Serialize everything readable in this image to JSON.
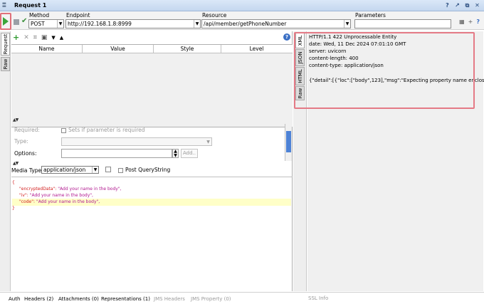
{
  "window": {
    "title": "Request 1",
    "grip_icon": "grip-icon",
    "controls": [
      "help-icon",
      "popout-icon",
      "restore-icon",
      "close-icon"
    ]
  },
  "toolbar": {
    "method_label": "Method",
    "method_value": "POST",
    "endpoint_label": "Endpoint",
    "endpoint_value": "http://192.168.1.8:8999",
    "resource_label": "Resource",
    "resource_value": "/api/member/getPhoneNumber",
    "parameters_label": "Parameters",
    "parameters_value": ""
  },
  "left_tabs": {
    "request": "Request",
    "raw": "Raw"
  },
  "params_table": {
    "columns": [
      "Name",
      "Value",
      "Style",
      "Level"
    ]
  },
  "param_props": {
    "required_label": "Required:",
    "required_hint": "Sets if parameter is required",
    "type_label": "Type:",
    "options_label": "Options:",
    "add_label": "Add.."
  },
  "media": {
    "label": "Media Type",
    "value": "application/json",
    "post_query_label": "Post QueryString"
  },
  "body": {
    "open": "{",
    "lines": [
      {
        "key": "\"encryptedData\"",
        "value": "\"Add your name in the body\","
      },
      {
        "key": "\"iv\"",
        "value": "\"Add your name in the body\","
      },
      {
        "key": "\"code\"",
        "value": "\"Add your name in the body\","
      }
    ],
    "close": "}"
  },
  "bottom_tabs": {
    "auth": "Auth",
    "headers": "Headers (2)",
    "attachments": "Attachments (0)",
    "representations": "Representations (1)",
    "jms_headers": "JMS Headers",
    "jms_property": "JMS Property (0)",
    "ssl_info": "SSL Info"
  },
  "response": {
    "tabs": [
      "XML",
      "JSON",
      "HTML",
      "Raw"
    ],
    "lines": [
      "HTTP/1.1 422 Unprocessable Entity",
      "date: Wed, 11 Dec 2024 07:01:10 GMT",
      "server: uvicorn",
      "content-length: 400",
      "content-type: application/json",
      "",
      "{\"detail\":[{\"loc\":[\"body\",123],\"msg\":\"Expecting property name enclos"
    ]
  }
}
